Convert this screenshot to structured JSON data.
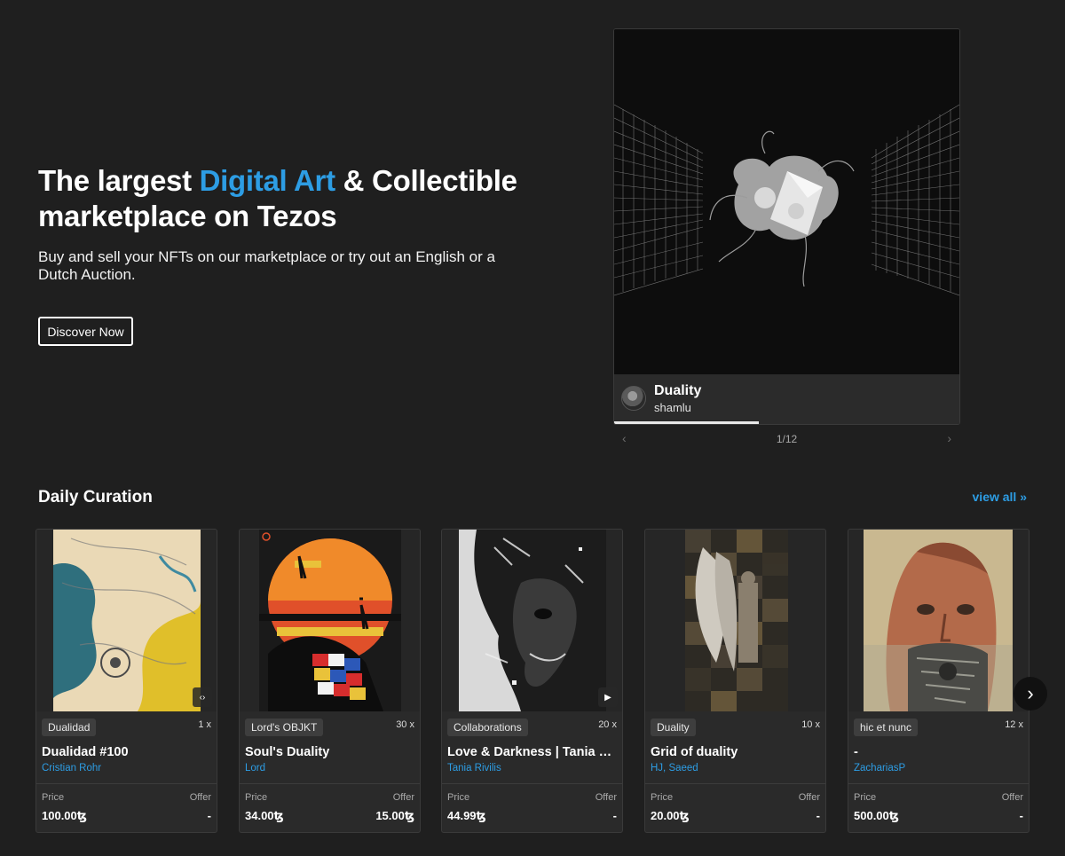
{
  "hero": {
    "title_part1": "The largest ",
    "title_accent": "Digital Art",
    "title_part2": " & Collectible marketplace on Tezos",
    "subtitle": "Buy and sell your NFTs on our marketplace or try out an English or a Dutch Auction.",
    "cta_label": "Discover Now"
  },
  "featured": {
    "title": "Duality",
    "artist": "shamlu",
    "counter": "1/12",
    "progress": 0.42
  },
  "section": {
    "title": "Daily Curation",
    "view_all": "view all »"
  },
  "cards": [
    {
      "tag": "Dualidad",
      "count": "1",
      "count_suffix": "x",
      "title": "Dualidad #100",
      "artist": "Cristian Rohr",
      "price_label": "Price",
      "offer_label": "Offer",
      "price": "100.00ꜩ",
      "offer": "-",
      "media_badge": "‹›"
    },
    {
      "tag": "Lord's OBJKT",
      "count": "30",
      "count_suffix": "x",
      "title": "Soul's Duality",
      "artist": "Lord",
      "price_label": "Price",
      "offer_label": "Offer",
      "price": "34.00ꜩ",
      "offer": "15.00ꜩ",
      "media_badge": ""
    },
    {
      "tag": "Collaborations",
      "count": "20",
      "count_suffix": "x",
      "title": "Love & Darkness | Tania Rivilis",
      "artist": "Tania Rivilis",
      "price_label": "Price",
      "offer_label": "Offer",
      "price": "44.99ꜩ",
      "offer": "-",
      "media_badge": "▶"
    },
    {
      "tag": "Duality",
      "count": "10",
      "count_suffix": "x",
      "title": "Grid of duality",
      "artist": "HJ, Saeed",
      "price_label": "Price",
      "offer_label": "Offer",
      "price": "20.00ꜩ",
      "offer": "-",
      "media_badge": ""
    },
    {
      "tag": "hic et nunc",
      "count": "12",
      "count_suffix": "x",
      "title": "-",
      "artist": "ZachariasP",
      "price_label": "Price",
      "offer_label": "Offer",
      "price": "500.00ꜩ",
      "offer": "-",
      "media_badge": ""
    }
  ],
  "icons": {
    "carousel_prev": "chevron-left-icon",
    "carousel_next": "chevron-right-icon",
    "cards_next": "chevron-right-icon",
    "code_badge": "code-icon",
    "video_badge": "play-icon"
  },
  "colors": {
    "background": "#1f1f1f",
    "accent": "#2d9de4",
    "card": "#2a2a2a"
  }
}
